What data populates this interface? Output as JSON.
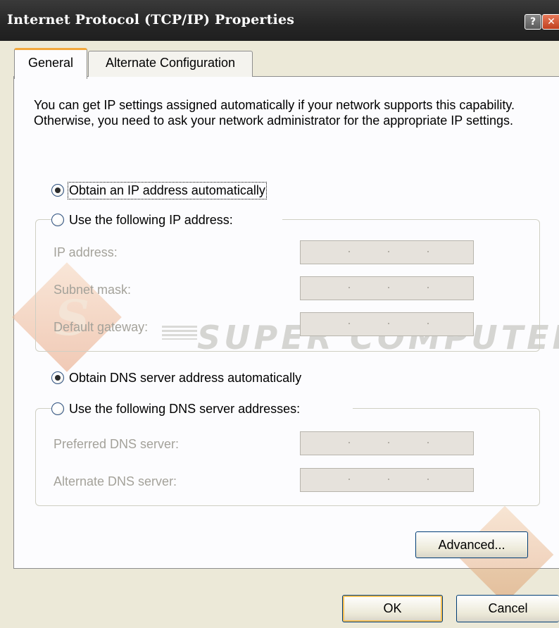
{
  "window": {
    "title": "Internet Protocol (TCP/IP) Properties",
    "help_glyph": "?",
    "close_glyph": "✕"
  },
  "tabs": [
    {
      "label": "General",
      "selected": true
    },
    {
      "label": "Alternate Configuration",
      "selected": false
    }
  ],
  "intro_text": "You can get IP settings assigned automatically if your network supports this capability. Otherwise, you need to ask your network administrator for the appropriate IP settings.",
  "ip_options": {
    "auto": {
      "label": "Obtain an IP address automatically",
      "selected": true
    },
    "manual": {
      "label": "Use the following IP address:",
      "selected": false
    }
  },
  "ip_fields": [
    {
      "label": "IP address:",
      "value": ". . ."
    },
    {
      "label": "Subnet mask:",
      "value": ". . ."
    },
    {
      "label": "Default gateway:",
      "value": ". . ."
    }
  ],
  "dns_options": {
    "auto": {
      "label": "Obtain DNS server address automatically",
      "selected": true
    },
    "manual": {
      "label": "Use the following DNS server addresses:",
      "selected": false
    }
  },
  "dns_fields": [
    {
      "label": "Preferred DNS server:",
      "value": ". . ."
    },
    {
      "label": "Alternate DNS server:",
      "value": ". . ."
    }
  ],
  "buttons": {
    "advanced": "Advanced...",
    "ok": "OK",
    "cancel": "Cancel"
  },
  "watermark": {
    "logo_letter": "S",
    "text": "SUPER COMPUTER"
  },
  "colors": {
    "titlebar": "#262626",
    "dialog_bg": "#ece9d8",
    "panel_bg": "#fcfcfe",
    "tab_accent": "#f3a83c",
    "disabled_text": "#a4a29a",
    "disabled_field": "#e6e2dc"
  }
}
